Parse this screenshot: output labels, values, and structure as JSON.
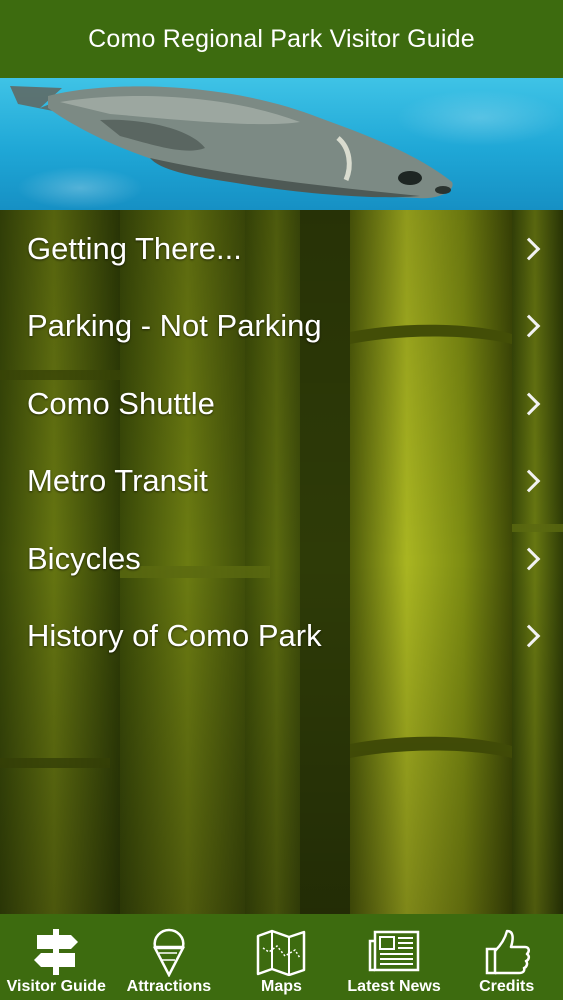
{
  "navbar": {
    "title": "Como Regional Park Visitor Guide"
  },
  "banner": {
    "image": "sea-lion-swimming-photo"
  },
  "background": {
    "image": "bamboo-stalks-photo"
  },
  "menu": {
    "items": [
      {
        "label": "Getting There..."
      },
      {
        "label": "Parking - Not Parking"
      },
      {
        "label": "Como Shuttle"
      },
      {
        "label": "Metro Transit"
      },
      {
        "label": "Bicycles"
      },
      {
        "label": "History of Como Park"
      }
    ]
  },
  "tabbar": {
    "tabs": [
      {
        "label": "Visitor Guide",
        "icon": "signpost-icon",
        "selected": true
      },
      {
        "label": "Attractions",
        "icon": "ice-cream-cone-icon",
        "selected": false
      },
      {
        "label": "Maps",
        "icon": "map-icon",
        "selected": false
      },
      {
        "label": "Latest News",
        "icon": "newspaper-icon",
        "selected": false
      },
      {
        "label": "Credits",
        "icon": "thumbs-up-icon",
        "selected": false
      }
    ]
  },
  "colors": {
    "bar_green": "#3d6b0f",
    "text": "#ffffff",
    "water_blue": "#1fa7d6",
    "bamboo": "#8a9a18"
  }
}
